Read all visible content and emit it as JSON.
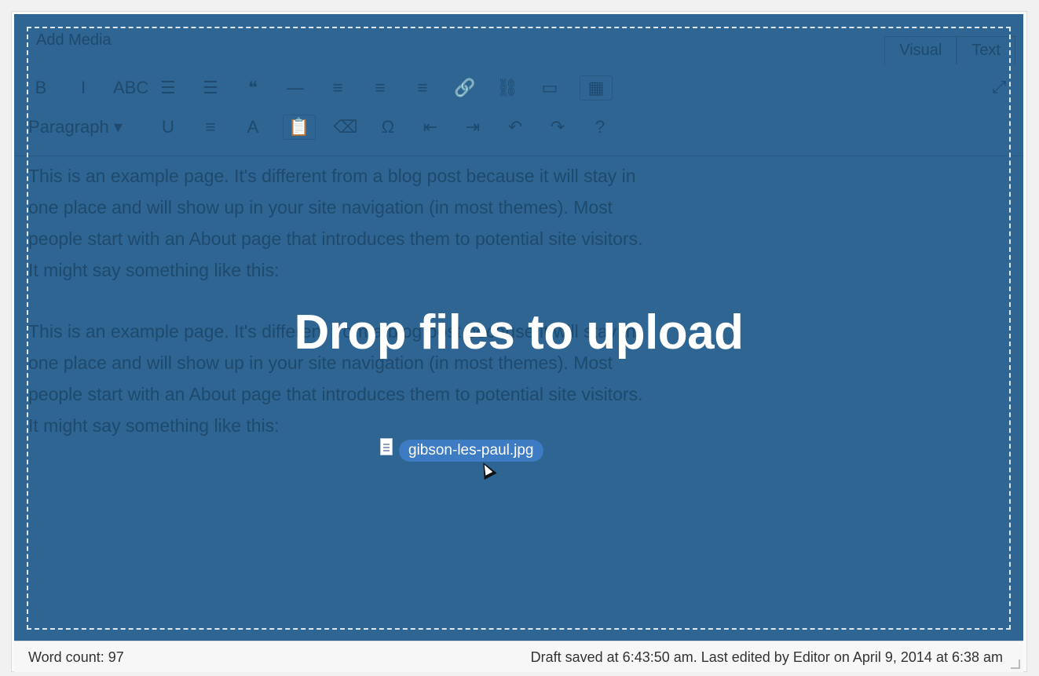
{
  "editor": {
    "add_media_label": "Add Media",
    "tabs": [
      "Visual",
      "Text"
    ],
    "toolbar_row1": [
      "B",
      "I",
      "ABC",
      "☰",
      "☰",
      "❝",
      "—",
      "≡",
      "≡",
      "≡",
      "🔗",
      "⛓",
      "▭",
      "▦"
    ],
    "toolbar_row2_para": "Paragraph",
    "toolbar_row2": [
      "U",
      "≡",
      "A",
      "📋",
      "⌫",
      "Ω",
      "⇤",
      "⇥",
      "↶",
      "↷",
      "?"
    ],
    "content_paragraphs": [
      "This is an example page. It's different from a blog post because it will stay in one place and will show up in your site navigation (in most themes). Most people start with an About page that introduces them to potential site visitors. It might say something like this:",
      "This is an example page. It's different from a blog post because it will stay in one place and will show up in your site navigation (in most themes). Most people start with an About page that introduces them to potential site visitors. It might say something like this:"
    ]
  },
  "overlay": {
    "title": "Drop files to upload",
    "dragged_file": "gibson-les-paul.jpg"
  },
  "status": {
    "word_count": "Word count: 97",
    "draft_info": "Draft saved at 6:43:50 am. Last edited by Editor on April 9, 2014 at 6:38 am"
  },
  "colors": {
    "overlay_blue": "#2e6593",
    "chip_blue": "#3d7cc2"
  },
  "icons": [
    "file-icon",
    "cursor-arrow-icon",
    "fullscreen-icon",
    "resize-handle-icon"
  ]
}
